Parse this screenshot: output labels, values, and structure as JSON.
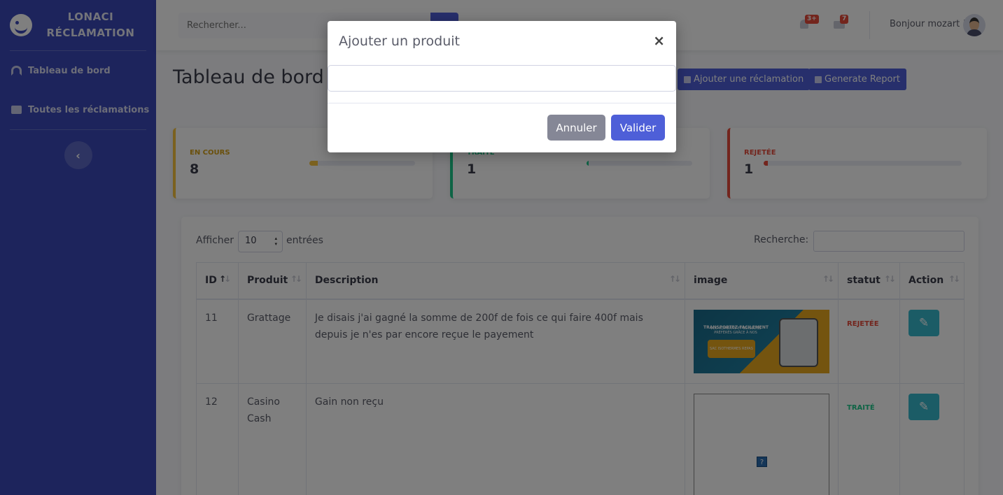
{
  "brand": {
    "line1": "LONACI",
    "line2": "RÉCLAMATION"
  },
  "sidebar": {
    "items": [
      {
        "label": "Tableau de bord",
        "icon": "gauge-icon"
      },
      {
        "label": "Toutes les réclamations",
        "icon": "ticket-icon"
      }
    ],
    "toggle_glyph": "‹"
  },
  "topbar": {
    "search_placeholder": "Rechercher...",
    "alerts_badge": "3+",
    "messages_badge": "7",
    "greeting": "Bonjour mozart !"
  },
  "page": {
    "title": "Tableau de bord",
    "add_button": "Ajouter une réclamation",
    "report_button": "Generate Report"
  },
  "cards": [
    {
      "label": "EN COURS",
      "value": "8",
      "color": "#f6c23e",
      "progress": 0.08
    },
    {
      "label": "TRAITÉ",
      "value": "1",
      "color": "#1cc88a",
      "progress": 0.01
    },
    {
      "label": "REJETÉE",
      "value": "1",
      "color": "#e74a3b",
      "progress": 0.01
    }
  ],
  "table": {
    "show_label": "Afficher",
    "page_length": "10",
    "entries_label": "entrées",
    "search_label": "Recherche:",
    "headers": [
      "ID",
      "Produit",
      "Description",
      "image",
      "statut",
      "Action"
    ],
    "rows": [
      {
        "id": "11",
        "product": "Grattage",
        "description": "Je disais j'ai gagné la somme de 200f de fois ce qui faire 400f mais depuis je n'es par encore reçue le payement",
        "status": "REJETÉE",
        "image": {
          "line1": "TRANSPORTEZ FACILEMENT",
          "line2": "VOS ALIMENTS ET BOISSONS PRÉFÉRÉS GRÂCE À NOS",
          "line3": "SAC ISOTHERMES REPAS"
        }
      },
      {
        "id": "12",
        "product": "Casino Cash",
        "description": "Gain non reçu",
        "status": "TRAITÉ",
        "image": null
      }
    ]
  },
  "modal": {
    "title": "Ajouter un produit",
    "close": "×",
    "cancel": "Annuler",
    "confirm": "Valider"
  },
  "colors": {
    "sidebar": "#3a48b8",
    "primary": "#4e5fd8",
    "info": "#36b9cc",
    "danger": "#e74a3b",
    "success": "#1cc88a",
    "warning": "#f6c23e"
  }
}
